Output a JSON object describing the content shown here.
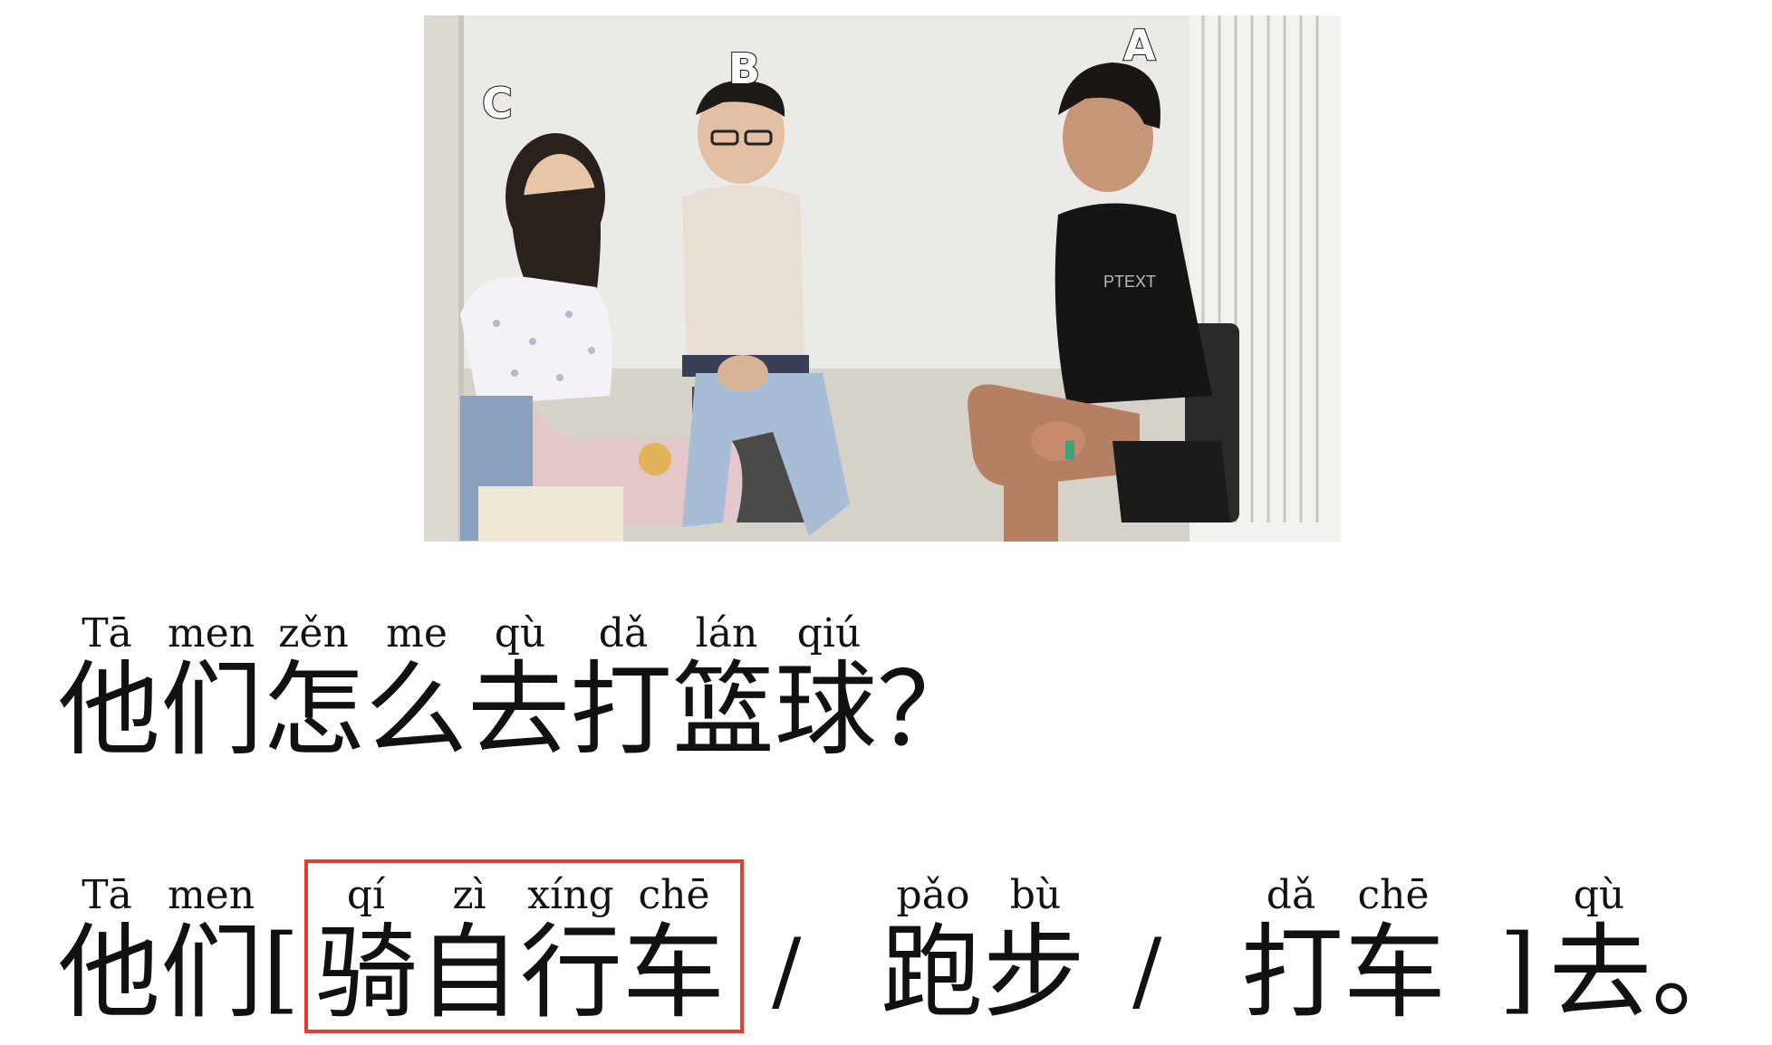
{
  "photo": {
    "labels": {
      "a": "A",
      "b": "B",
      "c": "C"
    }
  },
  "question": {
    "pinyin": [
      "Tā",
      "men",
      "zěn",
      "me",
      "qù",
      "dǎ",
      "lán",
      "qiú"
    ],
    "hanzi": "他们怎么去打篮球？"
  },
  "answer": {
    "pinyin": {
      "ta": "Tā",
      "men": "men",
      "qi": "qí",
      "zi": "zì",
      "xing": "xíng",
      "che": "chē",
      "pao": "pǎo",
      "bu": "bù",
      "da": "dǎ",
      "che2": "chē",
      "qu": "qù"
    },
    "hanzi": {
      "subject": "他们",
      "open_bracket": "[",
      "option1": "骑自行车",
      "slash1": "/",
      "option2": "跑步",
      "slash2": "/",
      "option3": "打车",
      "close_bracket": "]",
      "ending": "去。"
    }
  },
  "colors": {
    "highlight_border": "#e23d2d"
  }
}
